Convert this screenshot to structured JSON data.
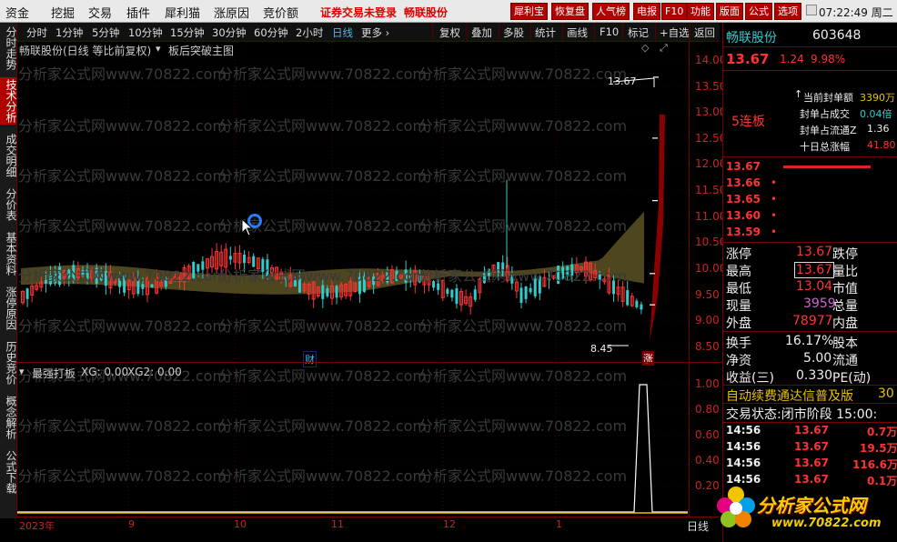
{
  "menu": {
    "items": [
      "资金",
      "挖掘",
      "交易",
      "插件",
      "犀利猫",
      "涨原因",
      "竞价额"
    ],
    "notice": "证券交易未登录",
    "stock_name": "畅联股份",
    "right_buttons": [
      "犀利宝",
      "恢复盘",
      "人气榜",
      "电报",
      "F10",
      "功能",
      "版面",
      "公式",
      "选项"
    ],
    "clock": "07:22:49 周二"
  },
  "left_tabs": [
    "分时走势",
    "技术分析",
    "成交明细",
    "分价表",
    "基本资料",
    "涨停原因",
    "历史竞价",
    "概念解析",
    "公式下载"
  ],
  "toolbar": {
    "periods": [
      "分时",
      "1分钟",
      "5分钟",
      "10分钟",
      "15分钟",
      "30分钟",
      "60分钟",
      "2小时",
      "日线",
      "更多 ›"
    ],
    "selected": "日线",
    "actions": [
      "复权",
      "叠加",
      "多股",
      "统计",
      "画线",
      "F10",
      "标记",
      "+自选",
      "返回"
    ]
  },
  "chart_header": {
    "title": "畅联股份(日线 等比前复权)",
    "indicator": "板后突破主图",
    "high_marker": "13.67",
    "low_marker": "8.45",
    "event_cai": "财",
    "event_zhang": "涨"
  },
  "price_axis": [
    "14.00",
    "13.50",
    "13.00",
    "12.50",
    "12.00",
    "11.50",
    "11.00",
    "10.50",
    "10.00",
    "9.50",
    "9.00",
    "8.50"
  ],
  "sub_chart": {
    "title": "最强打板",
    "xg_label": "XG: 0.00",
    "xg2_label": "XG2: 0.00",
    "axis": [
      "1.00",
      "0.80",
      "0.60",
      "0.40",
      "0.20"
    ]
  },
  "time_axis": [
    "2023年",
    "9",
    "10",
    "11",
    "12",
    "1"
  ],
  "bottom_right": "日线",
  "watermark": "分析家公式网www.70822.com",
  "quote": {
    "name": "畅联股份",
    "code": "603648",
    "price": "13.67",
    "change": "1.24",
    "pct": "9.98%",
    "limit_tag": "5连板",
    "seal_rows": [
      {
        "label": "当前封单额",
        "value": "3390万"
      },
      {
        "label": "封单占成交",
        "value": "0.04倍"
      },
      {
        "label": "封单占流通Z",
        "value": "1.36"
      },
      {
        "label": "十日总涨幅",
        "value": "41.80"
      }
    ],
    "book": [
      {
        "price": "13.67",
        "vol": ""
      },
      {
        "price": "13.66",
        "vol": "•"
      },
      {
        "price": "13.65",
        "vol": "•"
      },
      {
        "price": "13.60",
        "vol": "•"
      },
      {
        "price": "13.59",
        "vol": "•"
      }
    ],
    "stats": [
      {
        "l1": "涨停",
        "v1": "13.67",
        "l2": "跌停"
      },
      {
        "l1": "最高",
        "v1": "13.67",
        "l2": "量比"
      },
      {
        "l1": "最低",
        "v1": "13.04",
        "l2": "市值"
      },
      {
        "l1": "现量",
        "v1": "3959",
        "l2": "总量"
      },
      {
        "l1": "外盘",
        "v1": "78977",
        "l2": "内盘"
      }
    ],
    "stats2": [
      {
        "l1": "换手",
        "v1": "16.17%",
        "l2": "股本"
      },
      {
        "l1": "净资",
        "v1": "5.00",
        "l2": "流通"
      },
      {
        "l1": "收益(三)",
        "v1": "0.330",
        "l2": "PE(动)"
      }
    ],
    "auto_banner": "自动续费通达信普及版",
    "auto_banner_num": "30",
    "trade_status": "交易状态:闭市阶段 15:00:",
    "ticks": [
      {
        "t": "14:56",
        "p": "13.67",
        "v": "0.7万"
      },
      {
        "t": "14:56",
        "p": "13.67",
        "v": "19.5万"
      },
      {
        "t": "14:56",
        "p": "13.67",
        "v": "116.6万"
      },
      {
        "t": "14:56",
        "p": "13.67",
        "v": "0.1万"
      }
    ]
  },
  "logo": {
    "text": "分析家公式网",
    "url": "www.70822.com"
  },
  "colors": {
    "up": "#ff3333",
    "down": "#33cccc",
    "band": "#5a5224",
    "accent": "#b00000"
  }
}
